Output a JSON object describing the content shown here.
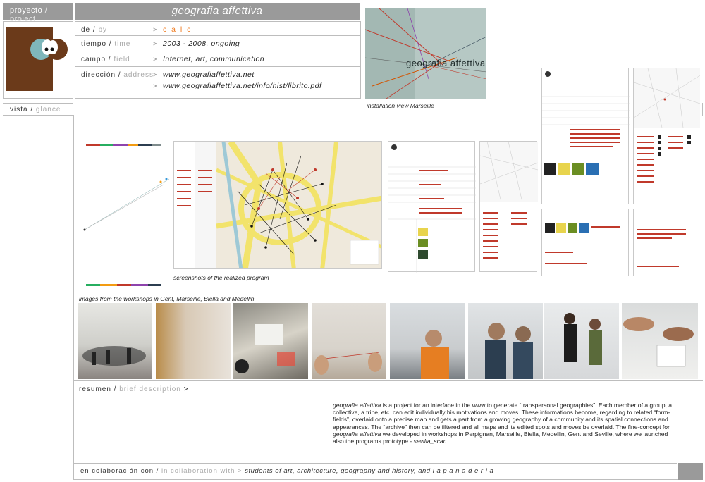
{
  "header": {
    "project_tab": {
      "es": "proyecto",
      "sep": " / ",
      "en": "project"
    },
    "title": "geografia affettiva"
  },
  "info": {
    "rows": [
      {
        "es": "de",
        "en": "by",
        "arrow": ">",
        "value": "c a l c"
      },
      {
        "es": "tiempo",
        "en": "time",
        "arrow": ">",
        "value": "2003 - 2008, ongoing"
      },
      {
        "es": "campo",
        "en": "field",
        "arrow": ">",
        "value": "Internet, art, communication"
      },
      {
        "es": "dirección",
        "en": "address",
        "arrow": ">",
        "value": "www.geografiaffettiva.net"
      },
      {
        "arrow": ">",
        "value": "www.geografiaffettiva.net/info/hist/librito.pdf"
      }
    ]
  },
  "install": {
    "photo_text": "geografia affettiva",
    "caption": "installation view Marseille"
  },
  "vista": {
    "es": "vista",
    "en": "glance"
  },
  "screens_caption": "screenshots of the realized program",
  "workshops_caption": "images from the workshops in Gent, Marseille, Biella and Medellin",
  "description": {
    "label_es": "resumen",
    "label_en": "brief description",
    "arrow": ">",
    "title_italic": "geografia affettiva",
    "text1": " is a project for an interface in the www to generate “transpersonal geographies”. Each member of a group, a collective, a tribe, etc. can edit individually his motivations and moves. These informations become, regarding to related “form-fields”, overlaid onto a precise map and gets a part from a growing geography of a community and its spatial connections and appearances. The “archive” then can be filtered and all maps and its edited spots and moves be overlaid. The fine-concept for ",
    "title_italic2": "geografia affettiva",
    "text2": " we developed in workshops in Perpignan, Marseille, Biella, Medellin, Gent and Seville, where we launched also the programs prototype - ",
    "proto": "sevilla_scan",
    "end": "."
  },
  "collab": {
    "es": "en colaboración con",
    "en": "in collaboration with",
    "arrow": ">",
    "text": "students of art, architecture, geography and history, and l a p a n a d e r i a"
  },
  "colors": {
    "header_gray": "#9a9a9a",
    "logo_brown": "#6b3a1a",
    "accent_orange": "#f07a1e",
    "map_yellow": "#f2e36b",
    "red": "#c0392b"
  }
}
